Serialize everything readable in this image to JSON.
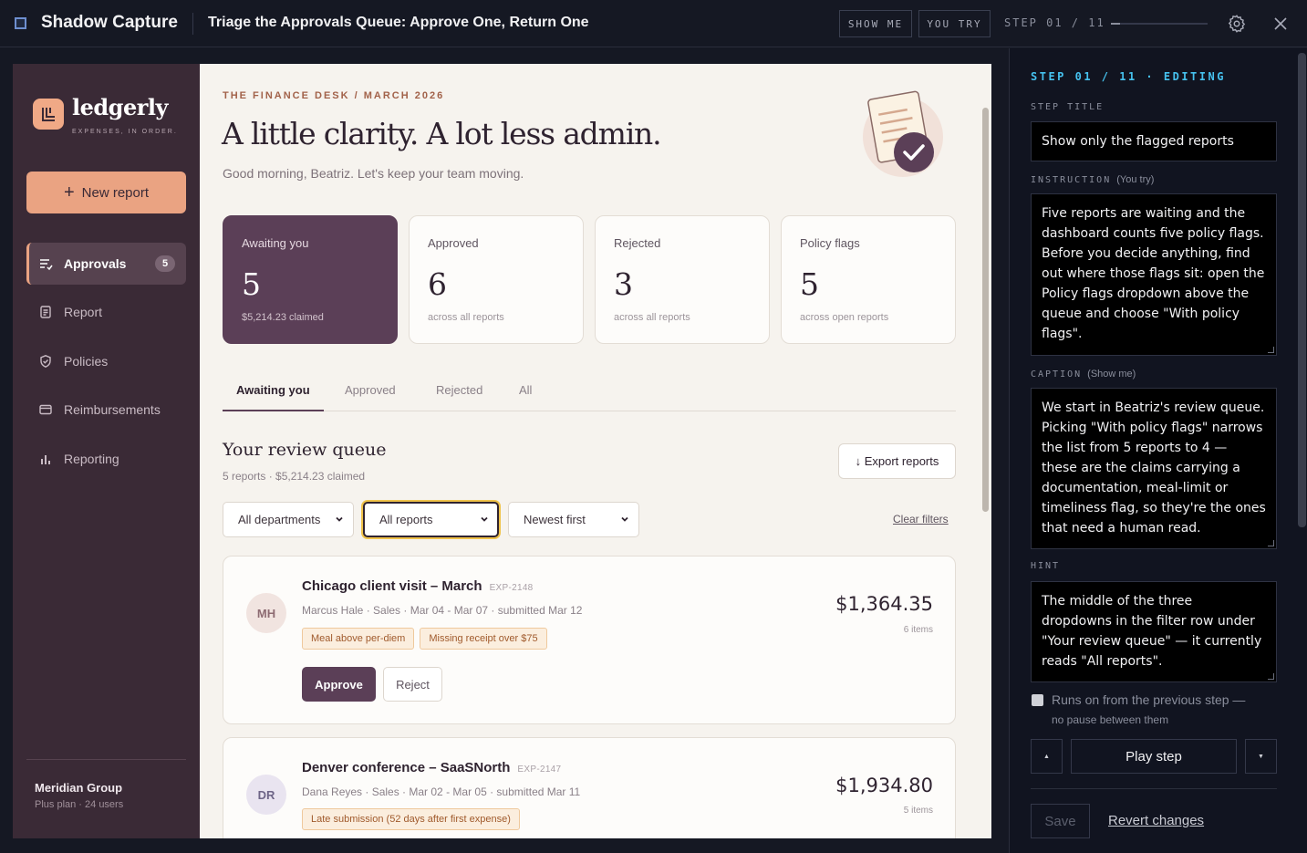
{
  "topbar": {
    "app_name": "Shadow Capture",
    "title": "Triage the Approvals Queue: Approve One, Return One",
    "show_me": "SHOW ME",
    "you_try": "YOU TRY",
    "step_label": "STEP 01 / 11",
    "step_progress": 0.09
  },
  "sidebar": {
    "brand_name": "ledgerly",
    "brand_tag": "EXPENSES, IN ORDER.",
    "new_report": "New report",
    "items": [
      {
        "label": "Approvals",
        "badge": "5",
        "icon": "approvals-list-icon"
      },
      {
        "label": "Report",
        "icon": "document-icon"
      },
      {
        "label": "Policies",
        "icon": "shield-check-icon"
      },
      {
        "label": "Reimbursements",
        "icon": "card-icon"
      },
      {
        "label": "Reporting",
        "icon": "bar-chart-icon"
      }
    ],
    "org_name": "Meridian Group",
    "org_plan": "Plus plan · 24 users"
  },
  "main": {
    "eyebrow": "THE FINANCE DESK / MARCH 2026",
    "headline": "A little clarity. A lot less admin.",
    "greeting": "Good morning, Beatriz. Let's keep your team moving.",
    "stats": [
      {
        "label": "Awaiting you",
        "value": "5",
        "sub": "$5,214.23 claimed"
      },
      {
        "label": "Approved",
        "value": "6",
        "sub": "across all reports"
      },
      {
        "label": "Rejected",
        "value": "3",
        "sub": "across all reports"
      },
      {
        "label": "Policy flags",
        "value": "5",
        "sub": "across open reports"
      }
    ],
    "tabs": [
      "Awaiting you",
      "Approved",
      "Rejected",
      "All"
    ],
    "queue_title": "Your review queue",
    "queue_sub": "5 reports · $5,214.23 claimed",
    "export": "↓ Export reports",
    "filters": {
      "department": "All departments",
      "flags": "All reports",
      "sort": "Newest first",
      "clear": "Clear filters"
    },
    "reports": [
      {
        "initials": "MH",
        "title": "Chicago client visit – March",
        "id": "EXP-2148",
        "meta": "Marcus Hale · Sales · Mar 04 - Mar 07 · submitted Mar 12",
        "amount": "$1,364.35",
        "items": "6 items",
        "flags": [
          "Meal above per-diem",
          "Missing receipt over $75"
        ],
        "approve": "Approve",
        "reject": "Reject"
      },
      {
        "initials": "DR",
        "title": "Denver conference – SaaSNorth",
        "id": "EXP-2147",
        "meta": "Dana Reyes · Sales · Mar 02 - Mar 05 · submitted Mar 11",
        "amount": "$1,934.80",
        "items": "5 items",
        "flags": [
          "Late submission (52 days after first expense)"
        ]
      }
    ]
  },
  "panel": {
    "head": "STEP 01 / 11 · EDITING",
    "step_title_label": "STEP TITLE",
    "step_title": "Show only the flagged reports",
    "instruction_label": "INSTRUCTION",
    "instruction_aside": "(You try)",
    "instruction": "Five reports are waiting and the dashboard counts five policy flags. Before you decide anything, find out where those flags sit: open the Policy flags dropdown above the queue and choose \"With policy flags\".",
    "caption_label": "CAPTION",
    "caption_aside": "(Show me)",
    "caption": "We start in Beatriz's review queue. Picking \"With policy flags\" narrows the list from 5 reports to 4 — these are the claims carrying a documentation, meal-limit or timeliness flag, so they're the ones that need a human read.",
    "hint_label": "HINT",
    "hint": "The middle of the three dropdowns in the filter row under \"Your review queue\" — it currently reads \"All reports\".",
    "runs_on": "Runs on from the previous step —",
    "runs_on_sub": "no pause between them",
    "play": "Play step",
    "up": "▲",
    "down": "▼",
    "save": "Save",
    "revert": "Revert changes"
  }
}
